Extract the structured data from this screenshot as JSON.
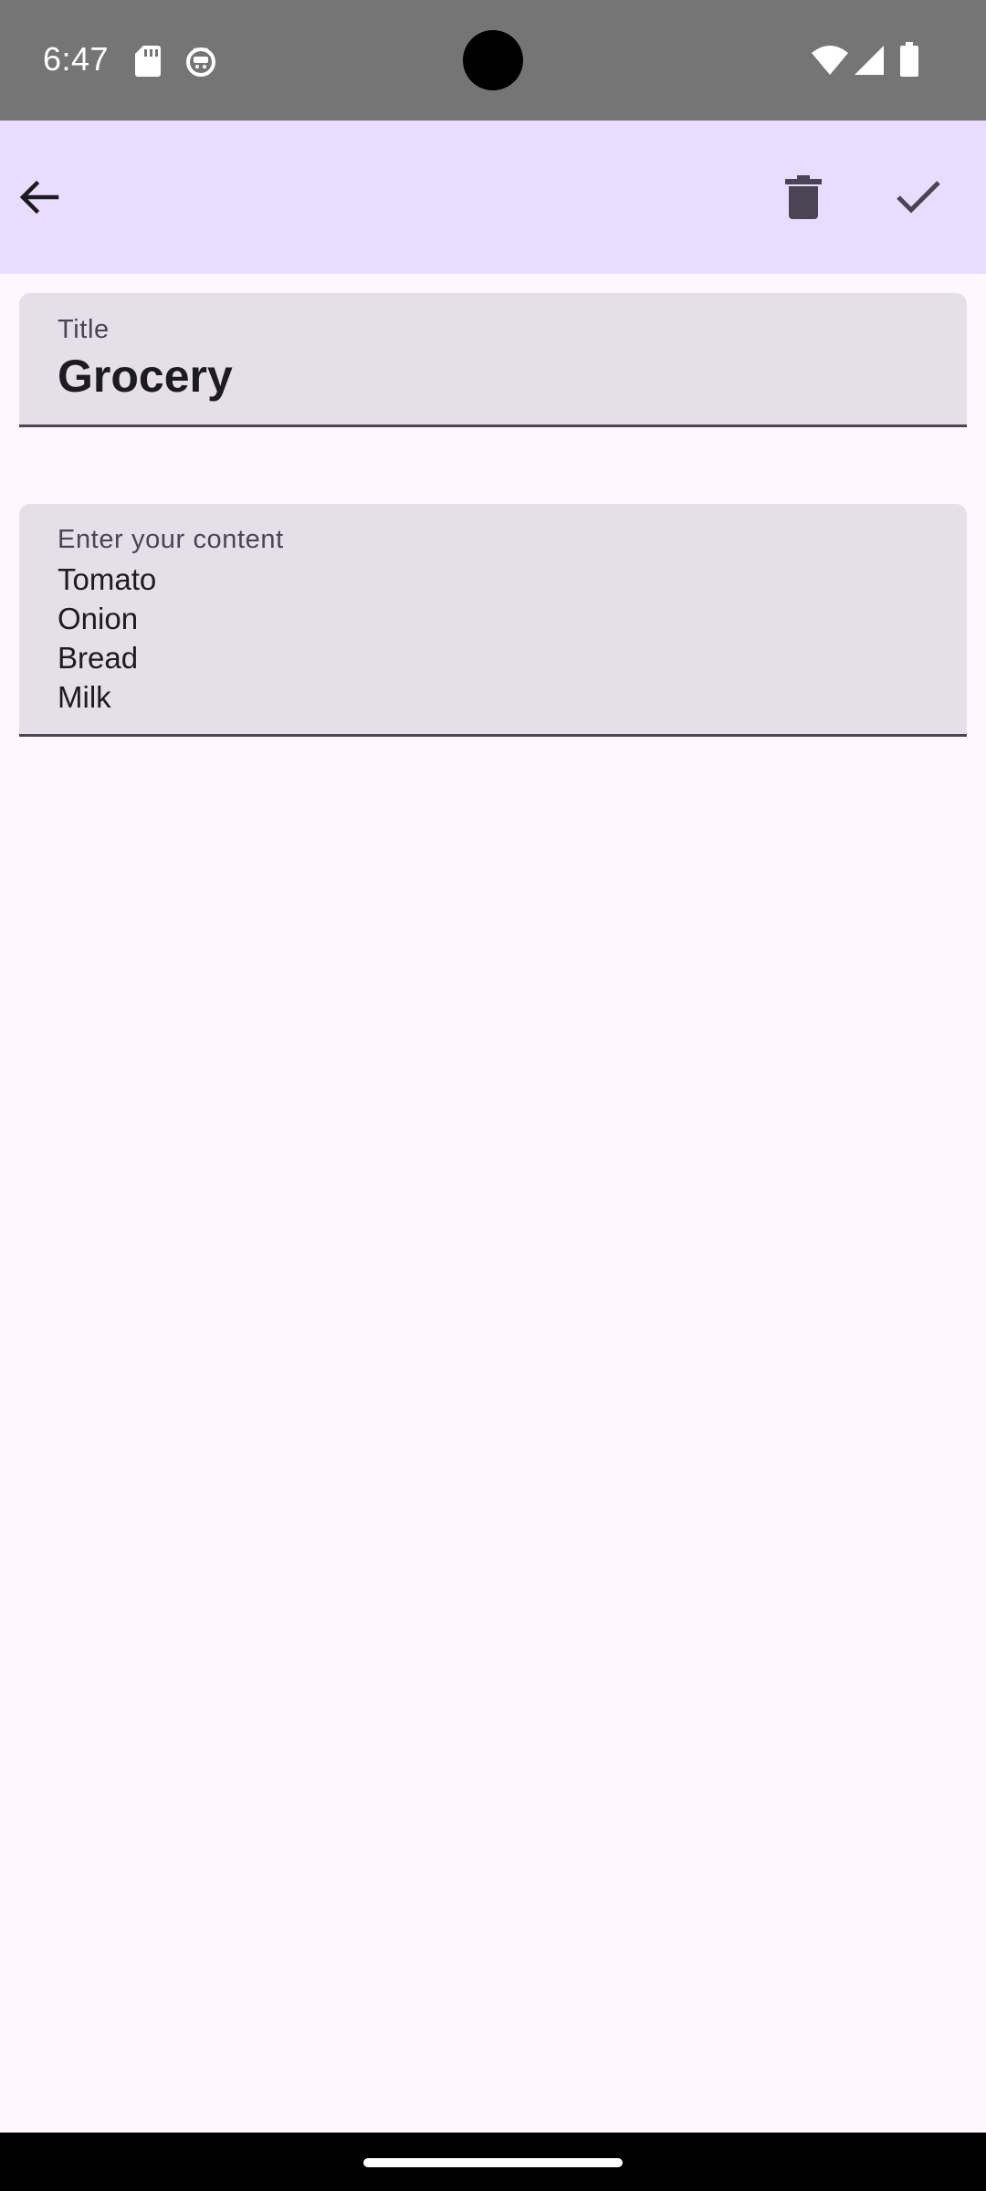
{
  "status_bar": {
    "time": "6:47",
    "left_icons": [
      "sd-card-icon",
      "cat-face-icon"
    ],
    "right_icons": [
      "wifi-icon",
      "cellular-signal-icon",
      "battery-icon"
    ],
    "background": "#757575"
  },
  "app_bar": {
    "background": "#eadcff",
    "back_icon": "arrow-back-icon",
    "delete_icon": "trash-icon",
    "save_icon": "checkmark-icon"
  },
  "note": {
    "title_label": "Title",
    "title_value": "Grocery",
    "content_label": "Enter your content",
    "content_lines": [
      "Tomato",
      "Onion",
      "Bread",
      "Milk"
    ]
  },
  "colors": {
    "field_background": "#e5dfea",
    "page_background": "#fef7fd"
  }
}
